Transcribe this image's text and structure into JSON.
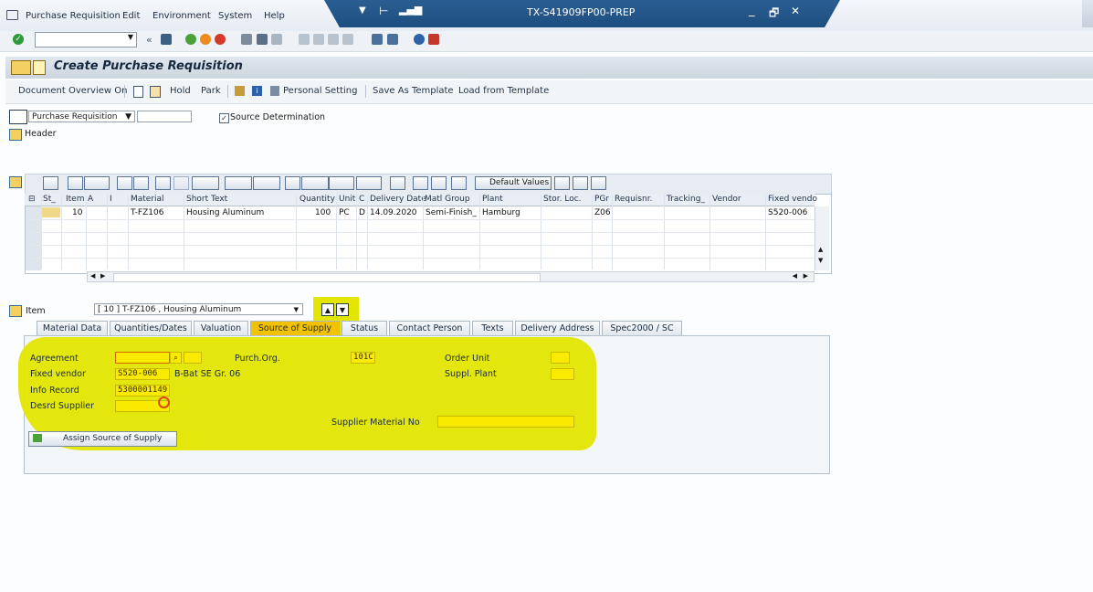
{
  "menu": [
    "Purchase Requisition",
    "Edit",
    "Environment",
    "System",
    "Help"
  ],
  "window_title": "TX-S41909FP00-PREP",
  "title_controls": {
    "minimize": "_",
    "maximize": "🗗",
    "close": "✕"
  },
  "page_title": "Create Purchase Requisition",
  "app_toolbar": {
    "document_overview": "Document Overview On",
    "hold": "Hold",
    "park": "Park",
    "personal_setting": "Personal Setting",
    "save_as_template": "Save As Template",
    "load_from_template": "Load from Template"
  },
  "doc_type": "Purchase Requisition",
  "source_determination": "Source Determination",
  "header_label": "Header",
  "grid_toolbar": {
    "default_values": "Default Values"
  },
  "grid": {
    "columns": [
      "St_",
      "Item",
      "A",
      "I",
      "Material",
      "Short Text",
      "Quantity",
      "Unit",
      "C",
      "Delivery Date",
      "Matl Group",
      "Plant",
      "Stor. Loc.",
      "PGr",
      "Requisnr.",
      "Tracking_",
      "Vendor",
      "Fixed vendo"
    ],
    "row": {
      "item": "10",
      "material": "T-FZ106",
      "short_text": "Housing Aluminum",
      "quantity": "100",
      "unit": "PC",
      "c": "D",
      "delivery_date": "14.09.2020",
      "matl_group": "Semi-Finish_",
      "plant": "Hamburg",
      "pgr": "Z06",
      "fixed_vendor": "S520-006"
    }
  },
  "item_label": "Item",
  "item_select": "[ 10 ] T-FZ106 , Housing Aluminum",
  "tabs": [
    "Material Data",
    "Quantities/Dates",
    "Valuation",
    "Source of Supply",
    "Status",
    "Contact Person",
    "Texts",
    "Delivery Address",
    "Spec2000 / SC"
  ],
  "active_tab": "Source of Supply",
  "source": {
    "agreement_label": "Agreement",
    "fixed_vendor_label": "Fixed vendor",
    "fixed_vendor": "S520-006",
    "fixed_vendor_name": "B-Bat SE Gr. 06",
    "info_record_label": "Info Record",
    "info_record": "5300001149",
    "desrd_supplier_label": "Desrd Supplier",
    "purch_org_label": "Purch.Org.",
    "purch_org": "101C",
    "order_unit_label": "Order Unit",
    "suppl_plant_label": "Suppl. Plant",
    "supplier_material_label": "Supplier Material No",
    "assign_button": "Assign Source of Supply"
  },
  "colors": {
    "highlight": "#e2e600",
    "sap_blue": "#1e4e80",
    "active_tab": "#f2c100"
  }
}
